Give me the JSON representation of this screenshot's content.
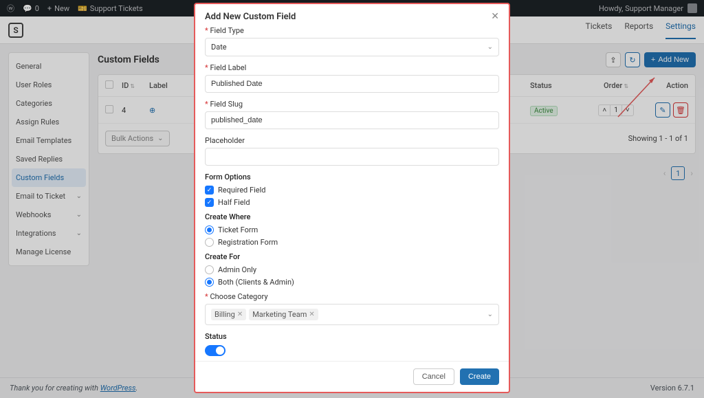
{
  "adminbar": {
    "comments_count": "0",
    "new_label": "New",
    "support_tickets_label": "Support Tickets",
    "howdy": "Howdy, Support Manager"
  },
  "logo": "S",
  "header": {
    "tabs": [
      "Tickets",
      "Reports",
      "Settings"
    ],
    "active": "Settings"
  },
  "sidebar": {
    "items": [
      {
        "label": "General",
        "expandable": false
      },
      {
        "label": "User Roles",
        "expandable": false
      },
      {
        "label": "Categories",
        "expandable": false
      },
      {
        "label": "Assign Rules",
        "expandable": false
      },
      {
        "label": "Email Templates",
        "expandable": false
      },
      {
        "label": "Saved Replies",
        "expandable": false
      },
      {
        "label": "Custom Fields",
        "expandable": false,
        "active": true
      },
      {
        "label": "Email to Ticket",
        "expandable": true
      },
      {
        "label": "Webhooks",
        "expandable": true
      },
      {
        "label": "Integrations",
        "expandable": true
      },
      {
        "label": "Manage License",
        "expandable": false
      }
    ]
  },
  "page": {
    "title": "Custom Fields",
    "add_new": "Add New",
    "columns": {
      "id": "ID",
      "label": "Label",
      "status": "Status",
      "order": "Order",
      "action": "Action"
    },
    "rows": [
      {
        "id": "4",
        "label": "",
        "status": "Active",
        "order": "1"
      }
    ],
    "bulk_actions": "Bulk Actions",
    "showing": "Showing 1 - 1 of 1",
    "page_num": "1"
  },
  "modal": {
    "title": "Add New Custom Field",
    "field_type_label": "Field Type",
    "field_type_value": "Date",
    "field_label_label": "Field Label",
    "field_label_value": "Published Date",
    "field_slug_label": "Field Slug",
    "field_slug_value": "published_date",
    "placeholder_label": "Placeholder",
    "placeholder_value": "",
    "form_options_label": "Form Options",
    "required_field": "Required Field",
    "half_field": "Half Field",
    "create_where_label": "Create Where",
    "ticket_form": "Ticket Form",
    "registration_form": "Registration Form",
    "create_for_label": "Create For",
    "admin_only": "Admin Only",
    "both_clients_admin": "Both (Clients & Admin)",
    "choose_category_label": "Choose Category",
    "categories": [
      "Billing",
      "Marketing Team"
    ],
    "status_label": "Status",
    "cancel": "Cancel",
    "create": "Create"
  },
  "footer": {
    "thankyou": "Thank you for creating with ",
    "wp": "WordPress",
    "period": ".",
    "version": "Version 6.7.1"
  }
}
